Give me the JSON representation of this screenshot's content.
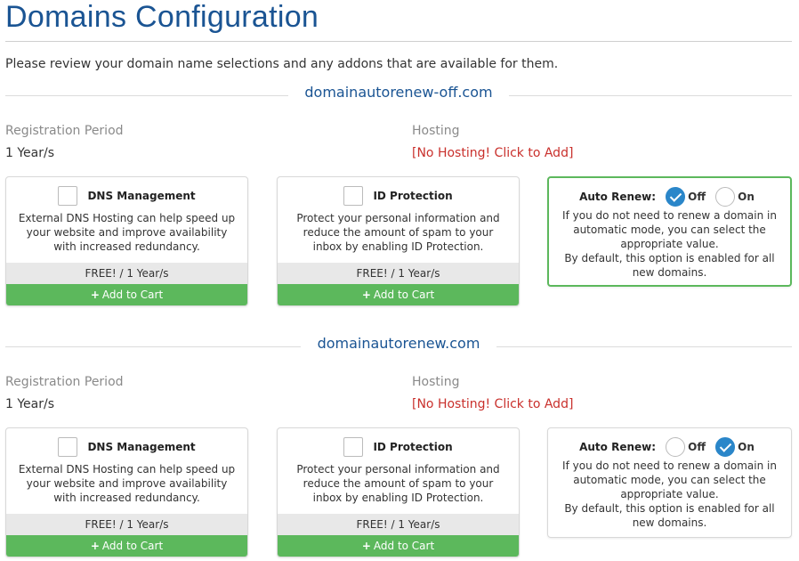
{
  "page": {
    "title": "Domains Configuration",
    "intro": "Please review your domain name selections and any addons that are available for them."
  },
  "labels": {
    "registration_period": "Registration Period",
    "hosting": "Hosting",
    "auto_renew": "Auto Renew:",
    "off": "Off",
    "on": "On"
  },
  "domains": [
    {
      "name": "domainautorenew-off.com",
      "registration_period": "1 Year/s",
      "hosting_link": "[No Hosting! Click to Add]",
      "auto_renew_selected": "off",
      "addons": [
        {
          "title": "DNS Management",
          "description": "External DNS Hosting can help speed up your website and improve availability with increased redundancy.",
          "price": "FREE! / 1 Year/s",
          "cart_label": "Add to Cart"
        },
        {
          "title": "ID Protection",
          "description": "Protect your personal information and reduce the amount of spam to your inbox by enabling ID Protection.",
          "price": "FREE! / 1 Year/s",
          "cart_label": "Add to Cart"
        }
      ],
      "renew_description": "If you do not need to renew a domain in automatic mode, you can select the appropriate value.\nBy default, this option is enabled for all new domains."
    },
    {
      "name": "domainautorenew.com",
      "registration_period": "1 Year/s",
      "hosting_link": "[No Hosting! Click to Add]",
      "auto_renew_selected": "on",
      "addons": [
        {
          "title": "DNS Management",
          "description": "External DNS Hosting can help speed up your website and improve availability with increased redundancy.",
          "price": "FREE! / 1 Year/s",
          "cart_label": "Add to Cart"
        },
        {
          "title": "ID Protection",
          "description": "Protect your personal information and reduce the amount of spam to your inbox by enabling ID Protection.",
          "price": "FREE! / 1 Year/s",
          "cart_label": "Add to Cart"
        }
      ],
      "renew_description": "If you do not need to renew a domain in automatic mode, you can select the appropriate value.\nBy default, this option is enabled for all new domains."
    }
  ],
  "colors": {
    "title": "#1a5493",
    "hosting_link": "#c9302c",
    "cart_button": "#5cb85c",
    "radio_checked": "#2a86c9"
  }
}
